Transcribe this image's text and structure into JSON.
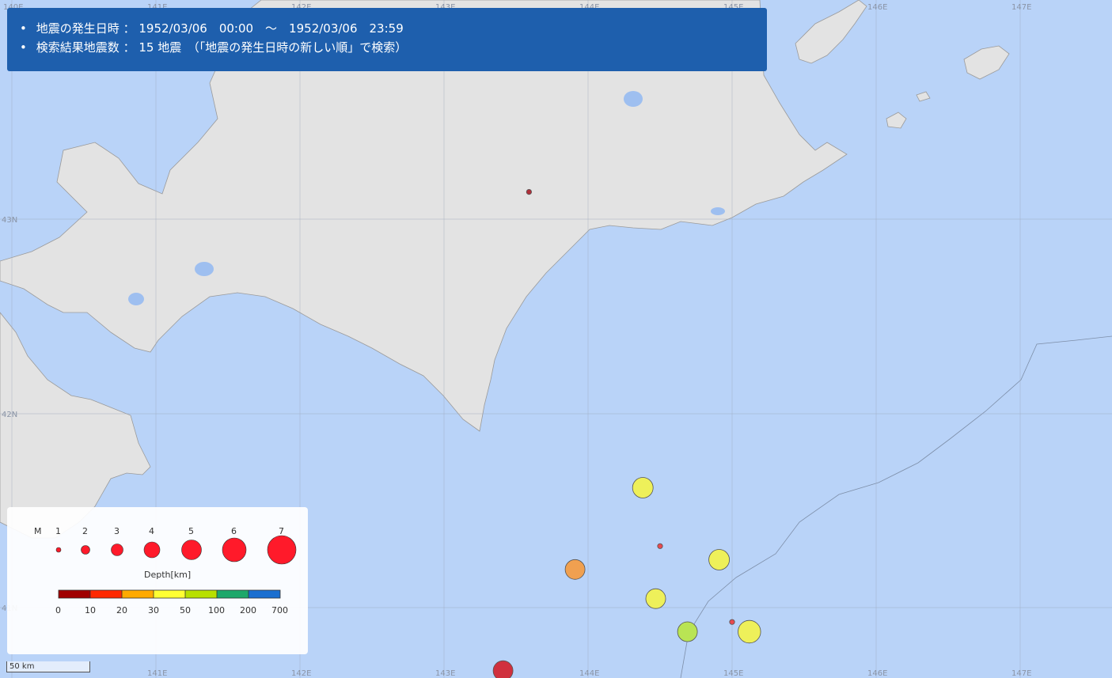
{
  "info": {
    "line1_label": "地震の発生日時",
    "line1_sep": "：",
    "line1_value": "1952/03/06　00:00　～　1952/03/06　23:59",
    "line2_label": "検索結果地震数",
    "line2_sep": "：",
    "line2_value": "15 地震　（「地震の発生日時の新しい順」で検索）"
  },
  "grid": {
    "longitude_labels": [
      "140E",
      "141E",
      "142E",
      "143E",
      "144E",
      "145E",
      "146E",
      "147E"
    ],
    "latitude_labels": [
      "43N",
      "42N",
      "41N"
    ]
  },
  "earthquakes": [
    {
      "lon": 144.38,
      "lat": 41.62,
      "magnitude": 5.0,
      "depth_color": "#eef05a"
    },
    {
      "lon": 144.5,
      "lat": 41.32,
      "magnitude": 1.5,
      "depth_color": "#e8494f"
    },
    {
      "lon": 144.91,
      "lat": 41.25,
      "magnitude": 5.0,
      "depth_color": "#eef05a"
    },
    {
      "lon": 143.91,
      "lat": 41.2,
      "magnitude": 4.8,
      "depth_color": "#f0a050"
    },
    {
      "lon": 144.47,
      "lat": 41.05,
      "magnitude": 4.8,
      "depth_color": "#eef05a"
    },
    {
      "lon": 144.69,
      "lat": 40.88,
      "magnitude": 4.8,
      "depth_color": "#b9e454"
    },
    {
      "lon": 145.0,
      "lat": 40.93,
      "magnitude": 1.5,
      "depth_color": "#e8494f"
    },
    {
      "lon": 145.12,
      "lat": 40.88,
      "magnitude": 5.5,
      "depth_color": "#eef05a"
    },
    {
      "lon": 143.41,
      "lat": 40.68,
      "magnitude": 4.8,
      "depth_color": "#d0303e"
    },
    {
      "lon": 143.59,
      "lat": 43.14,
      "magnitude": 1.5,
      "depth_color": "#b0303a"
    }
  ],
  "legend": {
    "magnitude_title": "M",
    "magnitudes": [
      "1",
      "2",
      "3",
      "4",
      "5",
      "6",
      "7"
    ],
    "depth_title": "Depth[km]",
    "depth_ticks": [
      "0",
      "10",
      "20",
      "30",
      "50",
      "100",
      "200",
      "700"
    ],
    "symbol_color": "#ff1a2a",
    "depth_colors": [
      "#8b0000",
      "#e60000",
      "#ff6a00",
      "#ffc400",
      "#ffff33",
      "#c8e600",
      "#2aa84a",
      "#1a7fd0",
      "#1a2a9a"
    ]
  },
  "scale": {
    "label": "50 km"
  },
  "colors": {
    "sea": "#b9d3f8",
    "land": "#e6e6e6",
    "info_panel": "#1e5fad"
  }
}
